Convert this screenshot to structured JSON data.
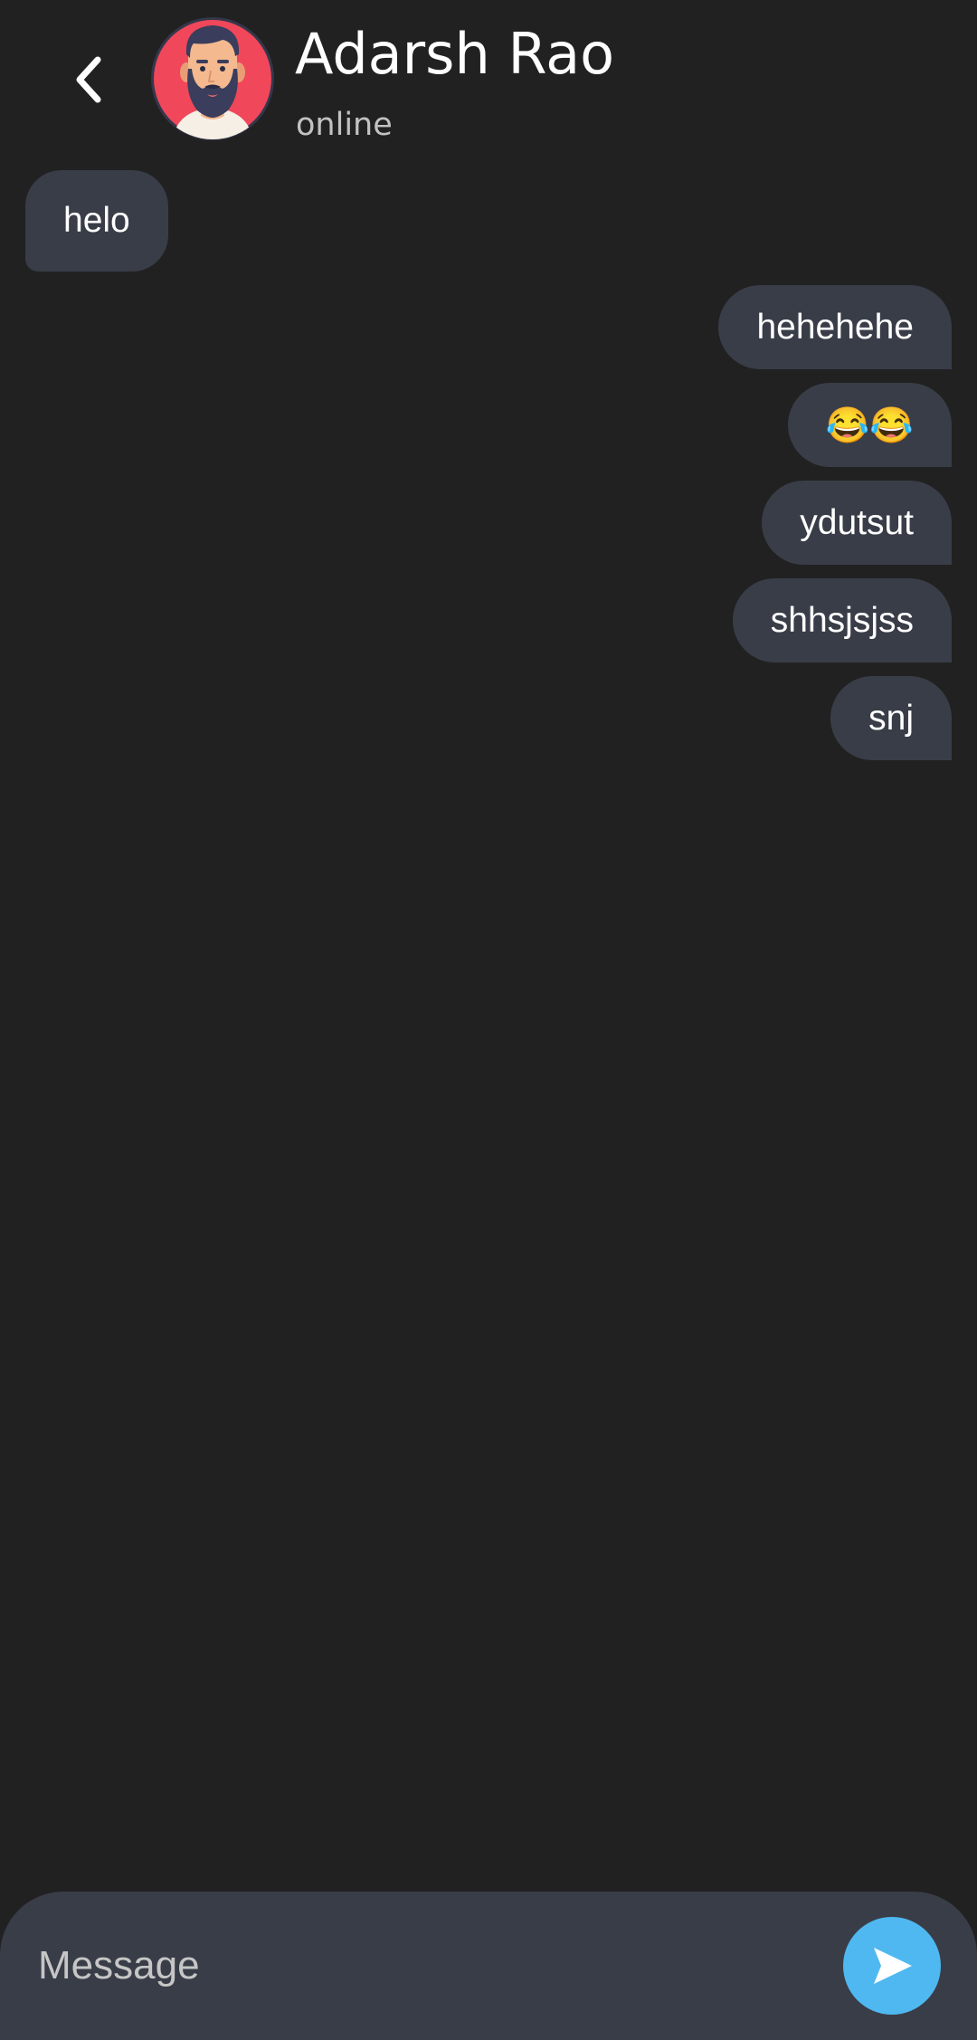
{
  "header": {
    "contact_name": "Adarsh Rao",
    "contact_status": "online",
    "back_icon": "chevron-left-icon",
    "avatar_icon": "bearded-man-avatar"
  },
  "messages": [
    {
      "direction": "incoming",
      "text": "helo"
    },
    {
      "direction": "outgoing",
      "text": "hehehehe"
    },
    {
      "direction": "outgoing",
      "text": "😂😂"
    },
    {
      "direction": "outgoing",
      "text": "ydutsut"
    },
    {
      "direction": "outgoing",
      "text": "shhsjsjss"
    },
    {
      "direction": "outgoing",
      "text": "snj"
    }
  ],
  "composer": {
    "placeholder": "Message",
    "value": "",
    "send_icon": "send-icon"
  },
  "colors": {
    "background": "#212121",
    "bubble": "#393d48",
    "send_button": "#4fb8f0",
    "avatar_ring": "#f0475a"
  }
}
